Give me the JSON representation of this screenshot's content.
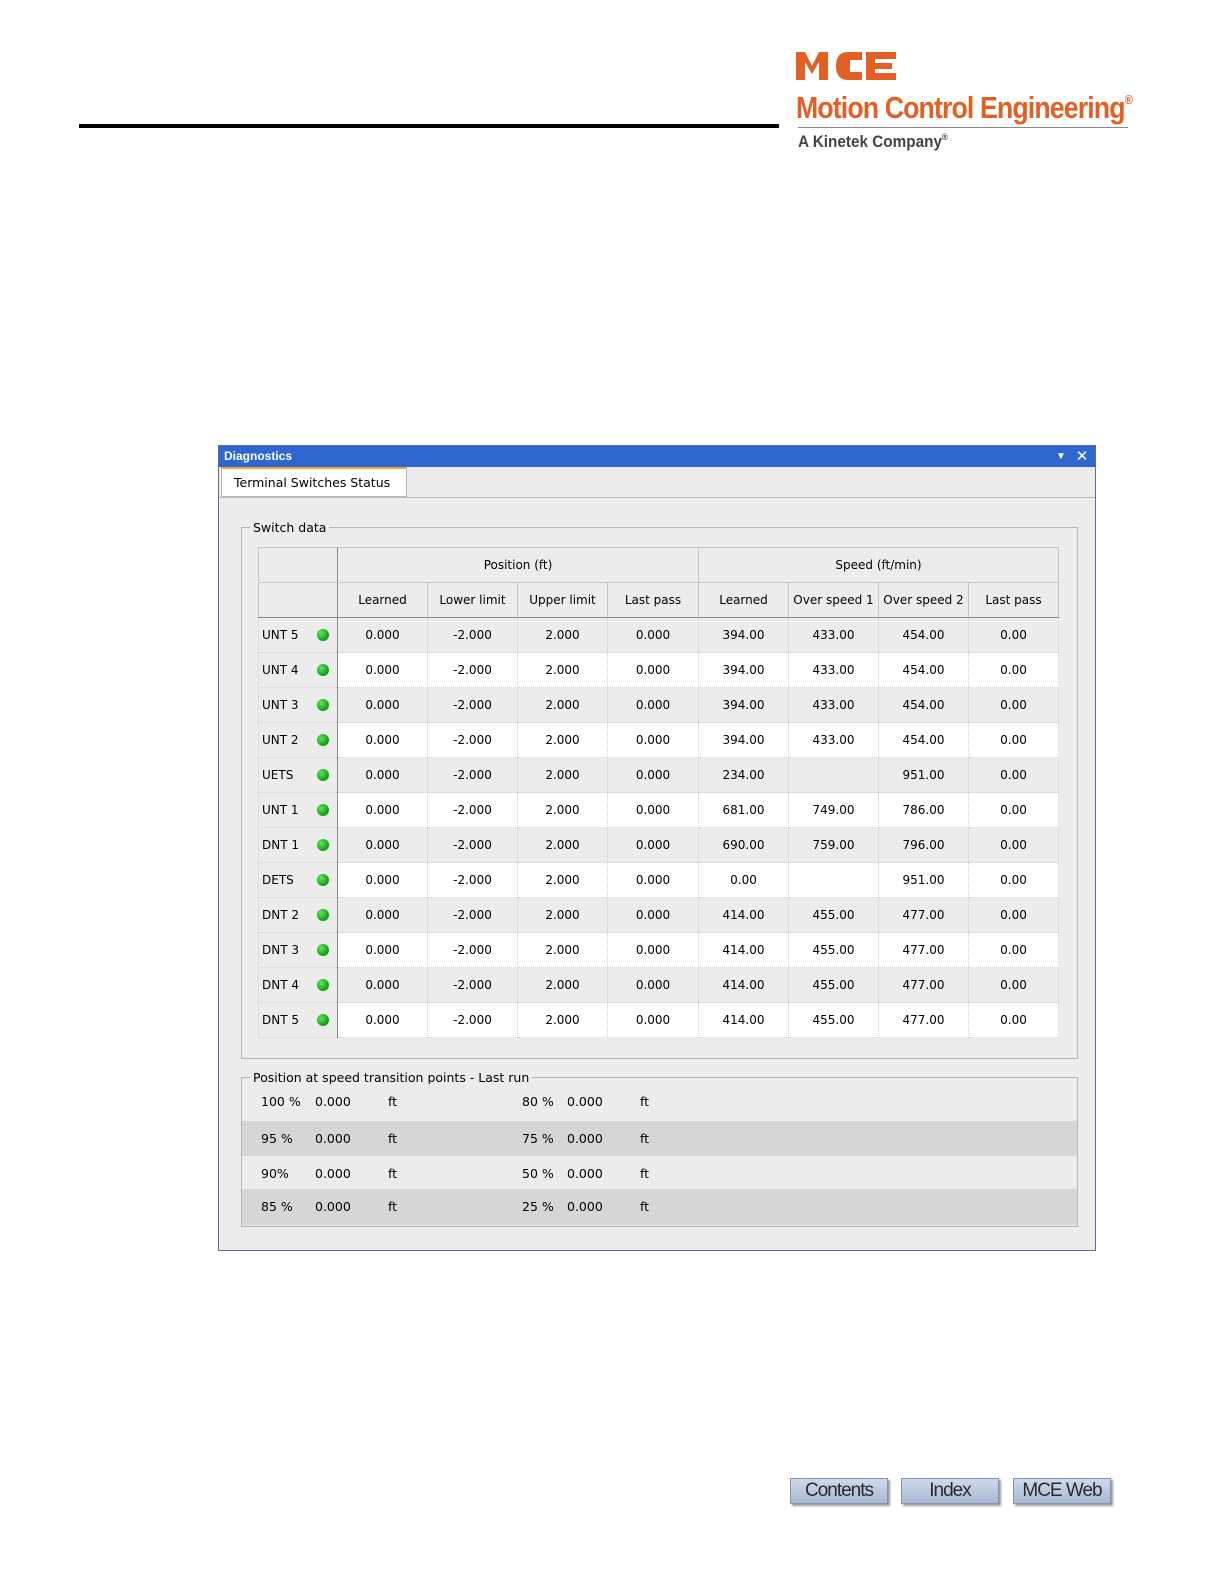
{
  "header": {
    "logo_mark": "MCE",
    "company_name": "Motion Control Engineering",
    "company_mark": "®",
    "tagline": "A Kinetek Company",
    "tagline_mark": "®",
    "brand_color": "#e35f23"
  },
  "window": {
    "title": "Diagnostics",
    "tab": "Terminal Switches Status",
    "title_bar_color": "#2f66cf",
    "menu_icon": "dropdown-arrow-icon",
    "close_icon": "close-icon"
  },
  "switch_data": {
    "legend": "Switch data",
    "group_headers": {
      "position": "Position (ft)",
      "speed": "Speed (ft/min)"
    },
    "columns": [
      "Learned",
      "Lower limit",
      "Upper limit",
      "Last pass",
      "Learned",
      "Over speed 1",
      "Over speed 2",
      "Last pass"
    ],
    "status_color": "#19a519",
    "rows": [
      {
        "name": "UNT 5",
        "cells": [
          "0.000",
          "-2.000",
          "2.000",
          "0.000",
          "394.00",
          "433.00",
          "454.00",
          "0.00"
        ]
      },
      {
        "name": "UNT 4",
        "cells": [
          "0.000",
          "-2.000",
          "2.000",
          "0.000",
          "394.00",
          "433.00",
          "454.00",
          "0.00"
        ]
      },
      {
        "name": "UNT 3",
        "cells": [
          "0.000",
          "-2.000",
          "2.000",
          "0.000",
          "394.00",
          "433.00",
          "454.00",
          "0.00"
        ]
      },
      {
        "name": "UNT 2",
        "cells": [
          "0.000",
          "-2.000",
          "2.000",
          "0.000",
          "394.00",
          "433.00",
          "454.00",
          "0.00"
        ]
      },
      {
        "name": "UETS",
        "cells": [
          "0.000",
          "-2.000",
          "2.000",
          "0.000",
          "234.00",
          "",
          "951.00",
          "0.00"
        ]
      },
      {
        "name": "UNT 1",
        "cells": [
          "0.000",
          "-2.000",
          "2.000",
          "0.000",
          "681.00",
          "749.00",
          "786.00",
          "0.00"
        ]
      },
      {
        "name": "DNT 1",
        "cells": [
          "0.000",
          "-2.000",
          "2.000",
          "0.000",
          "690.00",
          "759.00",
          "796.00",
          "0.00"
        ]
      },
      {
        "name": "DETS",
        "cells": [
          "0.000",
          "-2.000",
          "2.000",
          "0.000",
          "0.00",
          "",
          "951.00",
          "0.00"
        ]
      },
      {
        "name": "DNT 2",
        "cells": [
          "0.000",
          "-2.000",
          "2.000",
          "0.000",
          "414.00",
          "455.00",
          "477.00",
          "0.00"
        ]
      },
      {
        "name": "DNT 3",
        "cells": [
          "0.000",
          "-2.000",
          "2.000",
          "0.000",
          "414.00",
          "455.00",
          "477.00",
          "0.00"
        ]
      },
      {
        "name": "DNT 4",
        "cells": [
          "0.000",
          "-2.000",
          "2.000",
          "0.000",
          "414.00",
          "455.00",
          "477.00",
          "0.00"
        ]
      },
      {
        "name": "DNT 5",
        "cells": [
          "0.000",
          "-2.000",
          "2.000",
          "0.000",
          "414.00",
          "455.00",
          "477.00",
          "0.00"
        ]
      }
    ]
  },
  "transition": {
    "legend": "Position at speed transition points - Last run",
    "rows": [
      {
        "left_pct": "100 %",
        "left_val": "0.000",
        "left_unit": "ft",
        "right_pct": "80 %",
        "right_val": "0.000",
        "right_unit": "ft"
      },
      {
        "left_pct": "95 %",
        "left_val": "0.000",
        "left_unit": "ft",
        "right_pct": "75 %",
        "right_val": "0.000",
        "right_unit": "ft"
      },
      {
        "left_pct": "90%",
        "left_val": "0.000",
        "left_unit": "ft",
        "right_pct": "50 %",
        "right_val": "0.000",
        "right_unit": "ft"
      },
      {
        "left_pct": "85 %",
        "left_val": "0.000",
        "left_unit": "ft",
        "right_pct": "25 %",
        "right_val": "0.000",
        "right_unit": "ft"
      }
    ]
  },
  "nav": {
    "contents": "Contents",
    "index": "Index",
    "web": "MCE Web"
  }
}
